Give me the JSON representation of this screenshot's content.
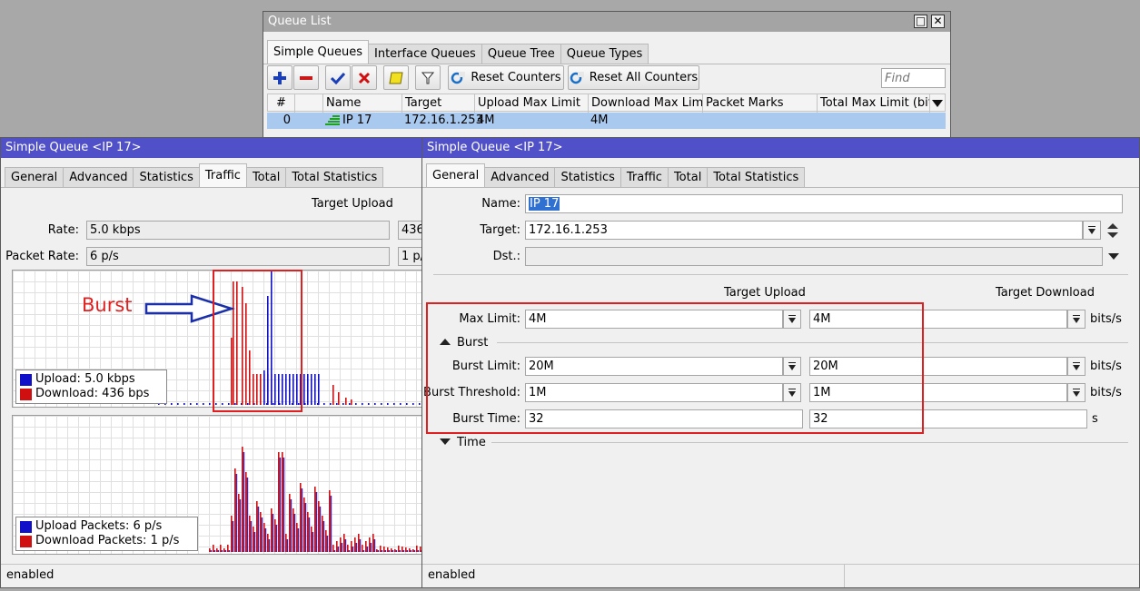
{
  "queue_list": {
    "title": "Queue List",
    "tabs": [
      "Simple Queues",
      "Interface Queues",
      "Queue Tree",
      "Queue Types"
    ],
    "toolbar": {
      "reset_counters": "Reset Counters",
      "reset_all_counters": "Reset All Counters",
      "find_placeholder": "Find"
    },
    "columns": [
      "#",
      "",
      "Name",
      "Target",
      "Upload Max Limit",
      "Download Max Limit",
      "Packet Marks",
      "Total Max Limit (bit..."
    ],
    "rows": [
      {
        "num": "0",
        "name": "IP 17",
        "target": "172.16.1.253",
        "upload_max_limit": "4M",
        "download_max_limit": "4M",
        "packet_marks": "",
        "total_max_limit": ""
      }
    ]
  },
  "traffic_window": {
    "title": "Simple Queue <IP 17>",
    "tabs": [
      "General",
      "Advanced",
      "Statistics",
      "Traffic",
      "Total",
      "Total Statistics"
    ],
    "column_header": "Target Upload",
    "rate_label": "Rate:",
    "rate_value": "5.0 kbps",
    "rate_value_2": "436",
    "packet_rate_label": "Packet Rate:",
    "packet_rate_value": "6 p/s",
    "packet_rate_value_2": "1 p/",
    "annotation": "Burst",
    "traffic_legend": {
      "upload": "Upload:  5.0 kbps",
      "download": "Download:  436 bps"
    },
    "packets_legend": {
      "upload": "Upload Packets:  6 p/s",
      "download": "Download Packets:  1 p/s"
    },
    "status": "enabled",
    "colors": {
      "upload": "#1010c8",
      "download": "#d01010",
      "annotation": "#e02020"
    }
  },
  "general_window": {
    "title": "Simple Queue <IP 17>",
    "tabs": [
      "General",
      "Advanced",
      "Statistics",
      "Traffic",
      "Total",
      "Total Statistics"
    ],
    "name_label": "Name:",
    "name_value": "IP 17",
    "target_label": "Target:",
    "target_value": "172.16.1.253",
    "dst_label": "Dst.:",
    "dst_value": "",
    "target_upload_header": "Target Upload",
    "target_download_header": "Target Download",
    "max_limit_label": "Max Limit:",
    "max_limit_upload": "4M",
    "max_limit_download": "4M",
    "burst_section": "Burst",
    "burst_limit_label": "Burst Limit:",
    "burst_limit_upload": "20M",
    "burst_limit_download": "20M",
    "burst_threshold_label": "Burst Threshold:",
    "burst_threshold_upload": "1M",
    "burst_threshold_download": "1M",
    "burst_time_label": "Burst Time:",
    "burst_time_upload": "32",
    "burst_time_download": "32",
    "unit_bits": "bits/s",
    "unit_s": "s",
    "time_section": "Time",
    "status": "enabled"
  }
}
